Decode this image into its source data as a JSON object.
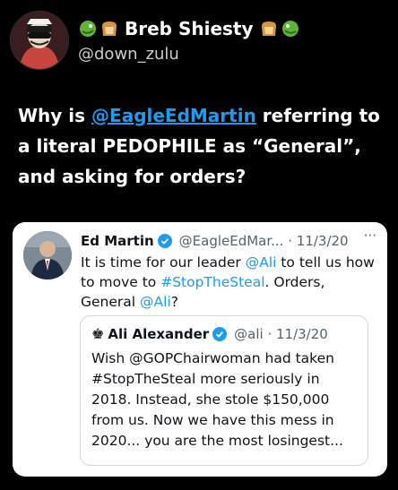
{
  "author": {
    "name": "Breb Shiesty",
    "handle": "@down_zulu",
    "emoji_left": [
      "dragon-icon",
      "bread-icon"
    ],
    "emoji_right": [
      "bread-icon",
      "dragon-icon"
    ]
  },
  "tweet": {
    "text_before": "Why is ",
    "mention": "@EagleEdMartin",
    "text_after": " referring to a literal PEDOPHILE as “General”, and asking for orders?"
  },
  "quoted": {
    "name": "Ed Martin",
    "meta": "@EagleEdMar... · 11/3/20",
    "more": "···",
    "body_parts": [
      {
        "t": "It is time for our leader ",
        "blue": false
      },
      {
        "t": "@Ali",
        "blue": true
      },
      {
        "t": " to tell us how to move to ",
        "blue": false
      },
      {
        "t": "#StopTheSteal",
        "blue": true
      },
      {
        "t": ". Orders, General ",
        "blue": false
      },
      {
        "t": "@Ali",
        "blue": true
      },
      {
        "t": "?",
        "blue": false
      }
    ]
  },
  "nested": {
    "name": "Ali Alexander",
    "meta": "@ali · 11/3/20",
    "body": "Wish @GOPChairwoman had taken #StopTheSteal more seriously in 2018. Instead, she stole $150,000 from us. Now we have this mess in 2020... you are the most losingest..."
  },
  "colors": {
    "background": "#000000",
    "mention_blue": "#1d9bf0",
    "card_bg": "#ffffff"
  }
}
